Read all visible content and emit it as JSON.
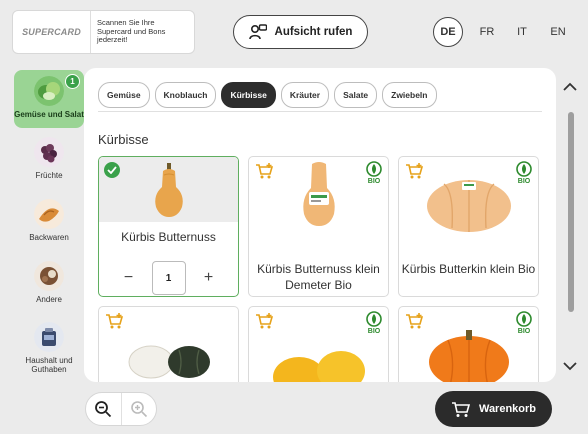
{
  "header": {
    "card_logo": "SUPERCARD",
    "card_text": [
      "Scannen Sie Ihre",
      "Supercard und Bons",
      "jederzeit!"
    ],
    "assist_label": "Aufsicht rufen",
    "languages": [
      "DE",
      "FR",
      "IT",
      "EN"
    ],
    "active_language": "DE"
  },
  "sidebar": {
    "items": [
      {
        "label": "Gemüse und Salat",
        "icon": "vegetables-icon",
        "active": true,
        "badge": "1"
      },
      {
        "label": "Früchte",
        "icon": "fruit-icon",
        "active": false
      },
      {
        "label": "Backwaren",
        "icon": "bread-icon",
        "active": false
      },
      {
        "label": "Andere",
        "icon": "other-icon",
        "active": false
      },
      {
        "label": "Haushalt und Guthaben",
        "icon": "household-icon",
        "active": false
      }
    ]
  },
  "tabs": [
    "Gemüse",
    "Knoblauch",
    "Kürbisse",
    "Kräuter",
    "Salate",
    "Zwiebeln"
  ],
  "active_tab": "Kürbisse",
  "section_title": "Kürbisse",
  "products": [
    {
      "name": "Kürbis Butternuss",
      "selected": true,
      "quantity": "1",
      "bio": false
    },
    {
      "name": "Kürbis Butternuss klein Demeter Bio",
      "selected": false,
      "bio": true
    },
    {
      "name": "Kürbis Butterkin klein Bio",
      "selected": false,
      "bio": true
    },
    {
      "name": "",
      "selected": false,
      "bio": false
    },
    {
      "name": "",
      "selected": false,
      "bio": true
    },
    {
      "name": "",
      "selected": false,
      "bio": true
    }
  ],
  "bio_label": "BIO",
  "quantity_minus": "−",
  "quantity_plus": "+",
  "cart_label": "Warenkorb",
  "colors": {
    "accent_green": "#3aa14a",
    "active_side_bg": "#9ad494",
    "dark_button": "#2b2b2b"
  }
}
